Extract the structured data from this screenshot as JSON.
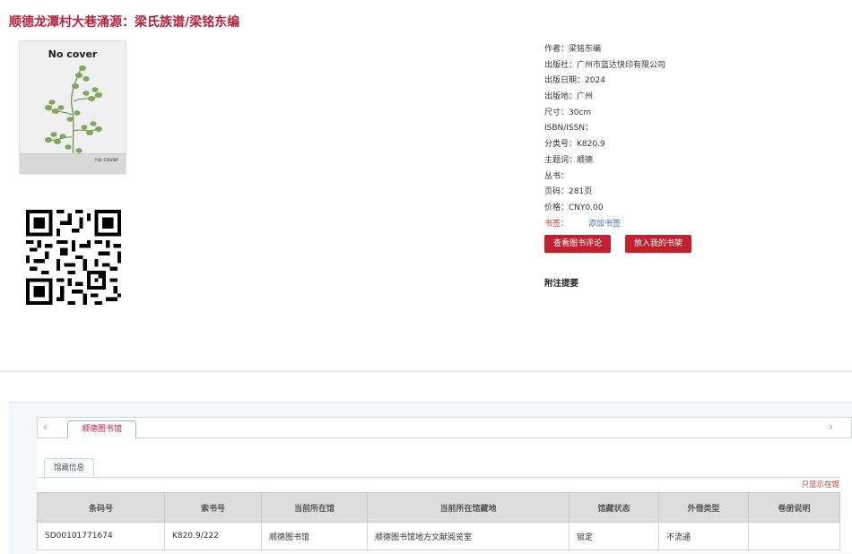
{
  "book": {
    "title": "顺德龙潭村大巷涌源：梁氏族谱/梁铭东编",
    "cover_top_text": "No cover",
    "cover_bottom_text": "no cover"
  },
  "info": [
    {
      "label": "作者：",
      "value": "梁铭东编"
    },
    {
      "label": "出版社：",
      "value": "广州市蓝达快印有限公司"
    },
    {
      "label": "出版日期：",
      "value": "2024"
    },
    {
      "label": "出版地：",
      "value": "广州"
    },
    {
      "label": "尺寸：",
      "value": "30cm"
    },
    {
      "label": "ISBN/ISSN：",
      "value": ""
    },
    {
      "label": "分类号：",
      "value": "K820.9"
    },
    {
      "label": "主题词：",
      "value": "顺德"
    },
    {
      "label": "丛书：",
      "value": ""
    },
    {
      "label": "页码：",
      "value": "281页"
    },
    {
      "label": "价格：",
      "value": "CNY0.00"
    }
  ],
  "bookmark": {
    "label": "书签：",
    "link": "添加书签"
  },
  "buttons": {
    "review": "查看图书评论",
    "shelf": "放入我的书架"
  },
  "notes_heading": "附注提要",
  "holdings": {
    "library_tab": "顺德图书馆",
    "sub_tab": "馆藏信息",
    "only_show": "只显示在馆",
    "headers": [
      "条码号",
      "索书号",
      "当前所在馆",
      "当前所在馆藏地",
      "馆藏状态",
      "外借类型",
      "卷册说明"
    ],
    "rows": [
      [
        "SD00101771674",
        "K820.9/222",
        "顺德图书馆",
        "顺德图书馆地方文献阅览室",
        "锁定",
        "不流通",
        ""
      ]
    ]
  },
  "colors": {
    "accent": "#c02130",
    "title": "#b5203a",
    "link": "#3a6fb5"
  }
}
